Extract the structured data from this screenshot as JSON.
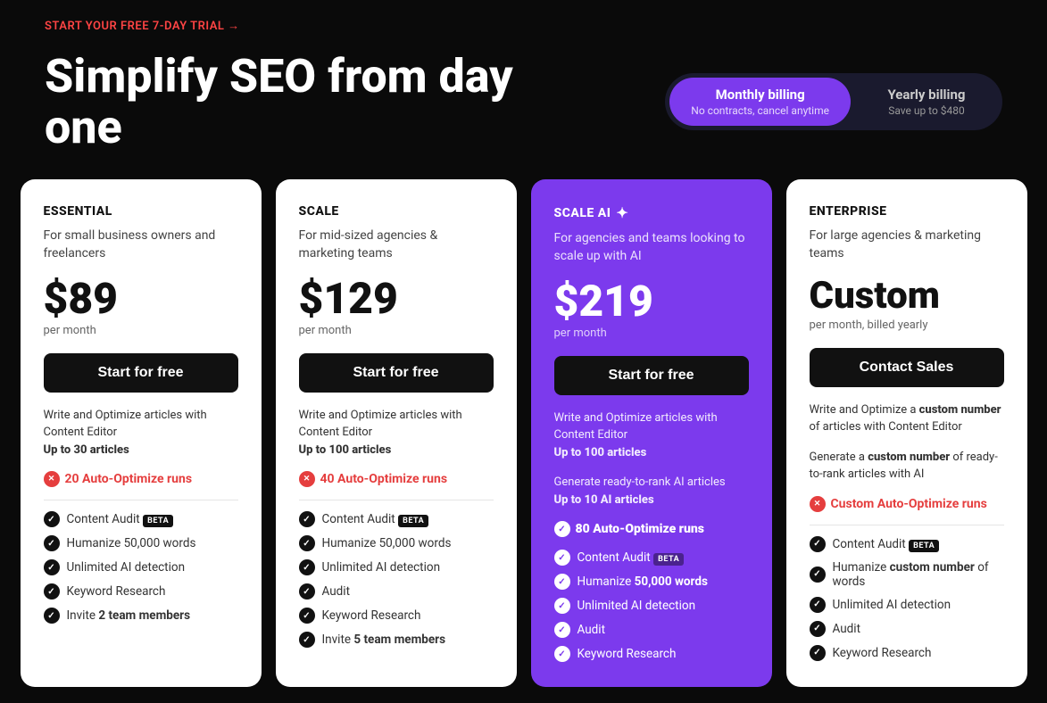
{
  "topBar": {
    "trialLink": "START YOUR FREE 7-DAY TRIAL →"
  },
  "header": {
    "headline": "Simplify SEO from day one",
    "billing": {
      "monthly": {
        "label": "Monthly billing",
        "sub": "No contracts, cancel anytime",
        "active": true
      },
      "yearly": {
        "label": "Yearly billing",
        "sub": "Save up to $480",
        "active": false
      }
    }
  },
  "plans": [
    {
      "id": "essential",
      "name": "ESSENTIAL",
      "desc": "For small business owners and freelancers",
      "price": "$89",
      "perMonth": "per month",
      "cta": "Start for free",
      "featuresIntro": "Write and Optimize articles with Content Editor",
      "articlesLimit": "Up to 30 articles",
      "autoOptimize": "20 Auto-Optimize runs",
      "features": [
        {
          "label": "Content Audit",
          "badge": "BETA"
        },
        {
          "label": "Humanize 50,000 words",
          "badge": null
        },
        {
          "label": "Unlimited AI detection",
          "badge": null
        },
        {
          "label": "Keyword Research",
          "badge": null
        },
        {
          "label": "Invite 2 team members",
          "bold": true,
          "badge": null
        }
      ]
    },
    {
      "id": "scale",
      "name": "SCALE",
      "desc": "For mid-sized agencies & marketing teams",
      "price": "$129",
      "perMonth": "per month",
      "cta": "Start for free",
      "featuresIntro": "Write and Optimize articles with Content Editor",
      "articlesLimit": "Up to 100 articles",
      "autoOptimize": "40 Auto-Optimize runs",
      "features": [
        {
          "label": "Content Audit",
          "badge": "BETA"
        },
        {
          "label": "Humanize 50,000 words",
          "badge": null
        },
        {
          "label": "Unlimited AI detection",
          "badge": null
        },
        {
          "label": "Audit",
          "badge": null
        },
        {
          "label": "Keyword Research",
          "badge": null
        },
        {
          "label": "Invite 5 team members",
          "bold": true,
          "badge": null
        }
      ]
    },
    {
      "id": "scale-ai",
      "name": "SCALE AI",
      "nameIcon": "✦",
      "desc": "For agencies and teams looking to scale up with AI",
      "price": "$219",
      "perMonth": "per month",
      "cta": "Start for free",
      "featuresIntro": "Write and Optimize articles with Content Editor",
      "articlesLimit": "Up to 100 articles",
      "aiIntro": "Generate ready-to-rank AI articles",
      "aiArticles": "Up to 10 AI articles",
      "autoOptimize": "80 Auto-Optimize runs",
      "features": [
        {
          "label": "Content Audit",
          "badge": "BETA"
        },
        {
          "label": "Humanize 50,000 words",
          "bold": true,
          "badge": null
        },
        {
          "label": "Unlimited AI detection",
          "badge": null
        },
        {
          "label": "Audit",
          "badge": null
        },
        {
          "label": "Keyword Research",
          "badge": null
        }
      ]
    },
    {
      "id": "enterprise",
      "name": "ENTERPRISE",
      "desc": "For large agencies & marketing teams",
      "price": "Custom",
      "perMonth": "per month, billed yearly",
      "cta": "Contact Sales",
      "featuresIntro1": "Write and Optimize a ",
      "featuresIntro1Bold": "custom number",
      "featuresIntro2": " of articles with Content Editor",
      "aiIntro1": "Generate a ",
      "aiIntro1Bold": "custom number",
      "aiIntro2": " of ready-to-rank articles with AI",
      "customAutoOptimize": "Custom Auto-Optimize runs",
      "features": [
        {
          "label": "Content Audit",
          "badge": "BETA"
        },
        {
          "label": "Humanize ",
          "boldPart": "custom number",
          "afterBold": " of words",
          "badge": null
        },
        {
          "label": "Unlimited AI detection",
          "badge": null
        },
        {
          "label": "Audit",
          "badge": null
        },
        {
          "label": "Keyword Research",
          "badge": null
        }
      ]
    }
  ]
}
